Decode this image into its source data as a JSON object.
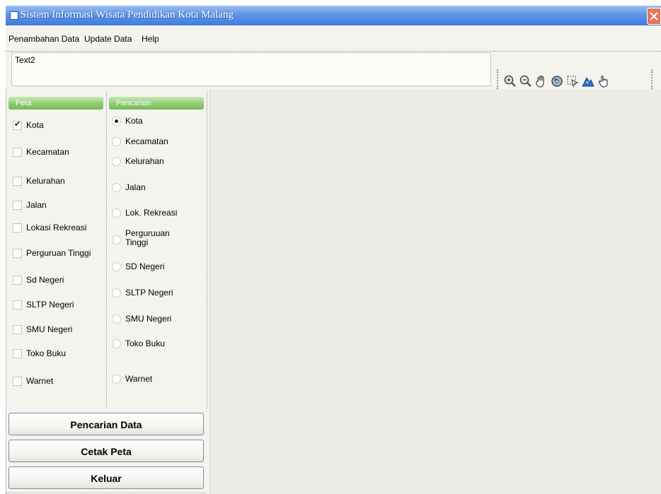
{
  "window": {
    "title": "Sistem Informasi Wisata Pendidikan Kota Malang"
  },
  "menu": [
    "Penambahan Data",
    "Update Data",
    "Help"
  ],
  "textbox": {
    "value": "Text2"
  },
  "toolbar": {
    "tools": [
      "zoom-in-icon",
      "zoom-out-icon",
      "pan-hand-icon",
      "full-extent-icon",
      "select-icon",
      "map-icon",
      "pointer-hand-icon"
    ]
  },
  "peta": {
    "header": "Peta",
    "items": [
      {
        "label": "Kota",
        "checked": true
      },
      {
        "label": "Kecamatan",
        "checked": false
      },
      {
        "label": "Kelurahan",
        "checked": false
      },
      {
        "label": "Jalan",
        "checked": false
      },
      {
        "label": "Lokasi Rekreasi",
        "checked": false
      },
      {
        "label": "Perguruan Tinggi",
        "checked": false
      },
      {
        "label": "Sd Negeri",
        "checked": false
      },
      {
        "label": "SLTP Negeri",
        "checked": false
      },
      {
        "label": "SMU Negeri",
        "checked": false
      },
      {
        "label": "Toko Buku",
        "checked": false
      },
      {
        "label": "Warnet",
        "checked": false
      }
    ]
  },
  "pencarian": {
    "header": "Pencarian",
    "items": [
      {
        "label": "Kota",
        "selected": true
      },
      {
        "label": "Kecamatan",
        "selected": false
      },
      {
        "label": "Kelurahan",
        "selected": false
      },
      {
        "label": "Jalan",
        "selected": false
      },
      {
        "label": "Lok. Rekreasi",
        "selected": false
      },
      {
        "label": "Perguruuan Tinggi",
        "selected": false
      },
      {
        "label": "SD Negeri",
        "selected": false
      },
      {
        "label": "SLTP Negeri",
        "selected": false
      },
      {
        "label": "SMU Negeri",
        "selected": false
      },
      {
        "label": "Toko Buku",
        "selected": false
      },
      {
        "label": "Warnet",
        "selected": false
      }
    ]
  },
  "buttons": {
    "search": "Pencarian Data",
    "print": "Cetak Peta",
    "exit": "Keluar"
  },
  "colors": {
    "title_bar": "#3f7ddc",
    "header_green": "#8fcc72",
    "map_bg": "#ecebe5",
    "close_red": "#e9735a"
  }
}
